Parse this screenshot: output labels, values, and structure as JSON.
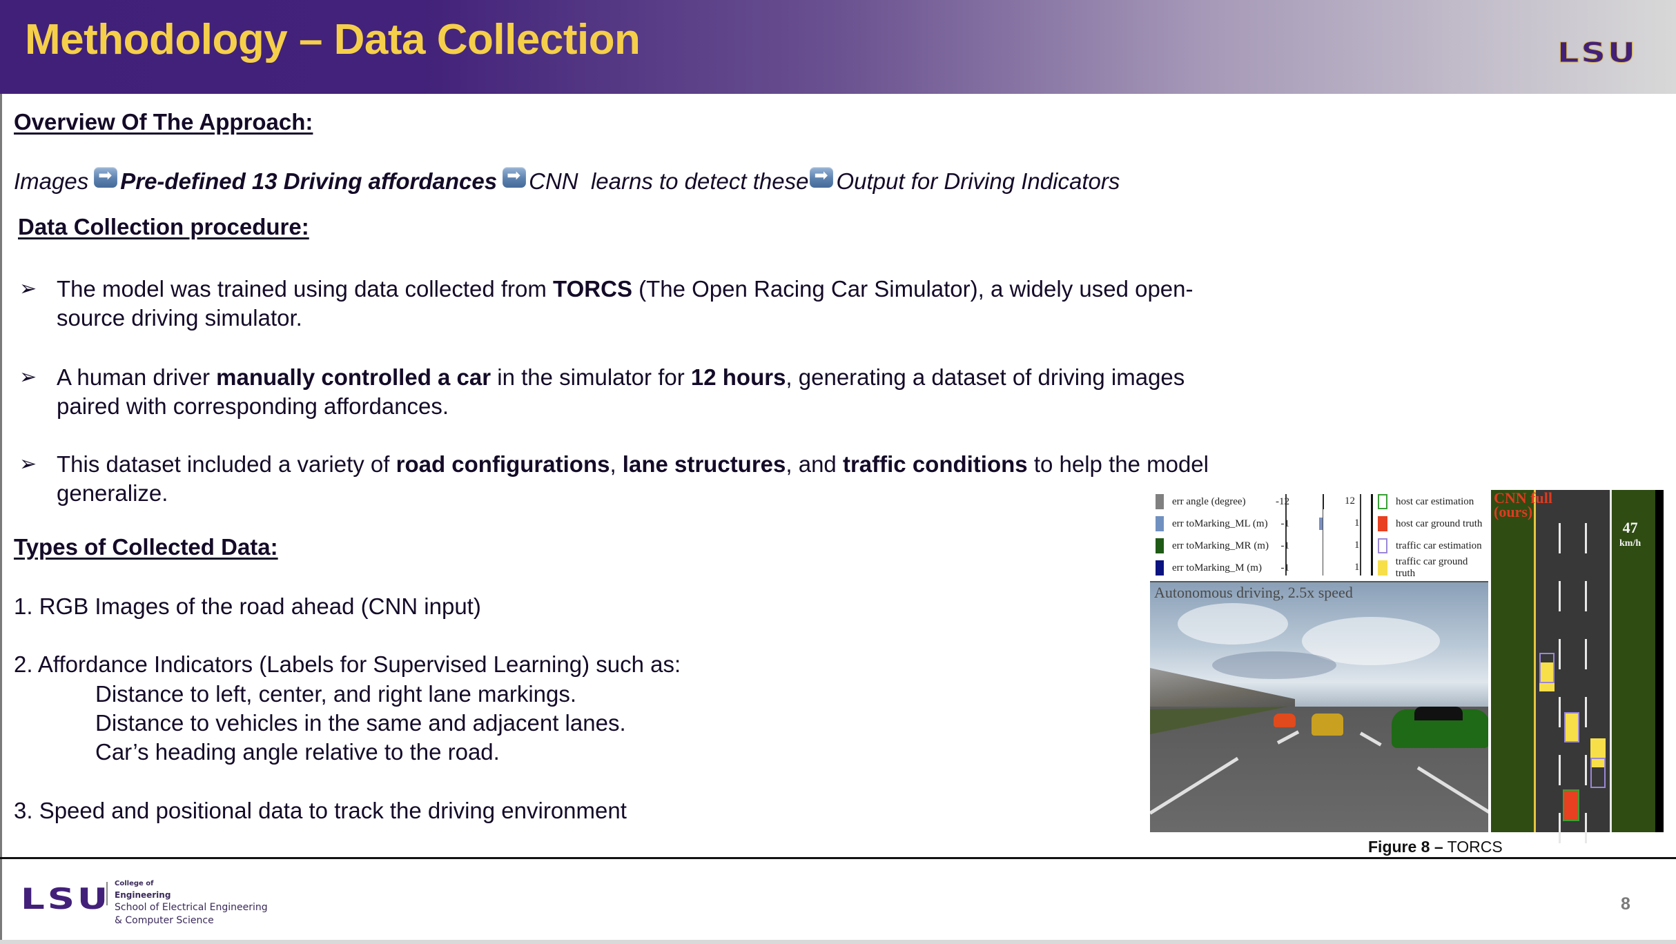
{
  "header": {
    "title": "Methodology – Data Collection",
    "logo": "LSU"
  },
  "overview": {
    "heading": "Overview Of The Approach:",
    "flow": [
      {
        "text": "Images",
        "bold": false
      },
      {
        "text": "Pre-defined 13 Driving affordances",
        "bold": true
      },
      {
        "text": "CNN  learns to detect these",
        "bold": false
      },
      {
        "text": "Output for Driving Indicators",
        "bold": false
      }
    ],
    "arrow_icon": "arrow-right-icon"
  },
  "procedure": {
    "heading": "Data Collection procedure:",
    "bullet_icon": "arrowhead-bullet-icon",
    "bullet_glyph": "➢",
    "bullets": [
      {
        "parts": [
          {
            "t": "The model was trained using data collected from ",
            "b": false
          },
          {
            "t": "TORCS",
            "b": true
          },
          {
            "t": " (The Open Racing Car Simulator), a widely used open-source driving simulator.",
            "b": false
          }
        ]
      },
      {
        "parts": [
          {
            "t": "A human driver ",
            "b": false
          },
          {
            "t": "manually controlled a car",
            "b": true
          },
          {
            "t": " in the simulator for ",
            "b": false
          },
          {
            "t": "12 hours",
            "b": true
          },
          {
            "t": ", generating a dataset of driving images paired with corresponding affordances.",
            "b": false
          }
        ]
      },
      {
        "parts": [
          {
            "t": "This dataset included a variety of ",
            "b": false
          },
          {
            "t": "road configurations",
            "b": true
          },
          {
            "t": ", ",
            "b": false
          },
          {
            "t": "lane structures",
            "b": true
          },
          {
            "t": ", and ",
            "b": false
          },
          {
            "t": "traffic conditions",
            "b": true
          },
          {
            "t": " to help the model generalize.",
            "b": false
          }
        ]
      }
    ]
  },
  "collected": {
    "heading": "Types of Collected Data:",
    "item1": "1. RGB Images of the road ahead (CNN input)",
    "item2": "2. Affordance Indicators (Labels for Supervised Learning)  such as:",
    "sub": [
      "Distance to left, center, and right lane markings.",
      "Distance to vehicles in the same and adjacent lanes.",
      "Car’s heading angle relative to the road."
    ],
    "item3": "3. Speed and positional data to track the driving environment"
  },
  "figure": {
    "legend_left": [
      {
        "label": "err angle (degree)",
        "min": "-12",
        "max": "12",
        "color": "#808080"
      },
      {
        "label": "err toMarking_ML (m)",
        "min": "-1",
        "max": "1",
        "color": "#7090c0"
      },
      {
        "label": "err toMarking_MR (m)",
        "min": "-1",
        "max": "1",
        "color": "#1f5a16"
      },
      {
        "label": "err toMarking_M (m)",
        "min": "-1",
        "max": "1",
        "color": "#0a1380"
      }
    ],
    "legend_right": [
      {
        "label": "host car estimation",
        "style": "outline",
        "color": "#3aa035"
      },
      {
        "label": "host car ground truth",
        "style": "fill",
        "color": "#e84020"
      },
      {
        "label": "traffic car estimation",
        "style": "outline",
        "color": "#9b87d6"
      },
      {
        "label": "traffic car ground truth",
        "style": "fill",
        "color": "#f7df4a"
      }
    ],
    "sim_title": "Autonomous driving, 2.5x speed",
    "method_label_1": "CNN full",
    "method_label_2": "(ours)",
    "speed_value": "47",
    "speed_unit": "km/h",
    "caption_bold": "Figure 8 –",
    "caption_text": " TORCS"
  },
  "footer": {
    "logo": "LSU",
    "line1": "College of",
    "line2": "Engineering",
    "line3": "School of Electrical Engineering",
    "line4": "& Computer Science",
    "page_number": "8"
  }
}
